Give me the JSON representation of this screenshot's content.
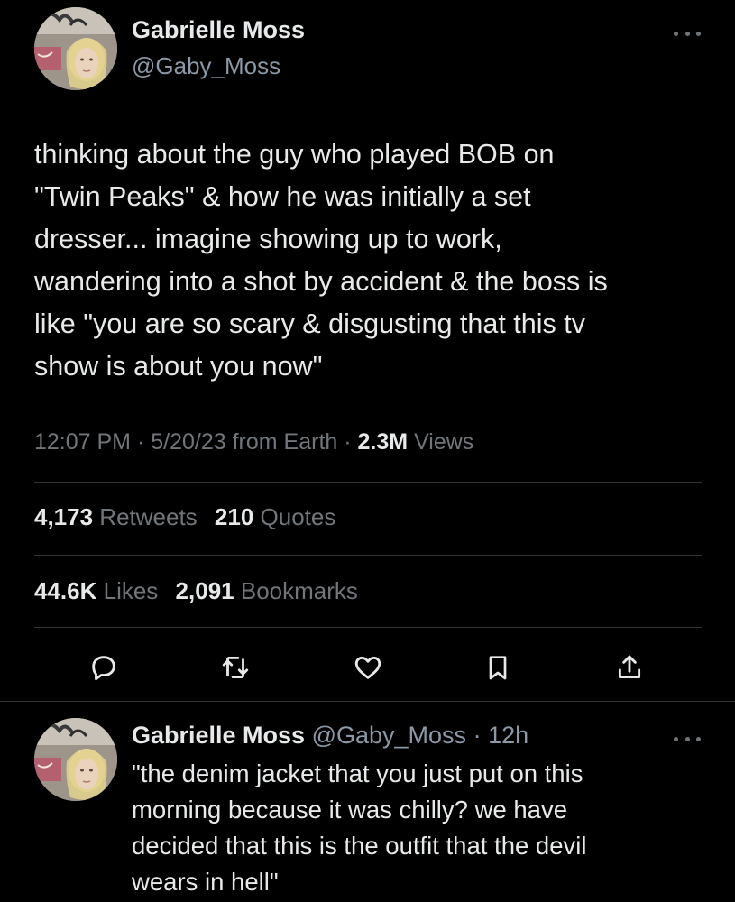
{
  "tweet": {
    "author_name": "Gabrielle Moss",
    "author_handle": "@Gaby_Moss",
    "text_lines": [
      "thinking about the guy who played BOB on",
      "\"Twin Peaks\" & how he was initially a set",
      "dresser... imagine showing up to work,",
      "wandering into a shot by accident & the boss is",
      "like \"you are so scary & disgusting that this tv",
      "show is about you now\""
    ],
    "meta": {
      "time": "12:07 PM",
      "sep1": " · ",
      "date": "5/20/23",
      "source": " from Earth",
      "sep2": " · ",
      "views_count": "2.3M",
      "views_label": " Views"
    },
    "stats_row1": {
      "retweets_count": "4,173",
      "retweets_label": " Retweets",
      "quotes_count": "210",
      "quotes_label": " Quotes"
    },
    "stats_row2": {
      "likes_count": "44.6K",
      "likes_label": " Likes",
      "bookmarks_count": "2,091",
      "bookmarks_label": " Bookmarks"
    },
    "actions": [
      "reply-icon",
      "retweet-icon",
      "like-icon",
      "bookmark-icon",
      "share-icon"
    ]
  },
  "reply": {
    "author_name": "Gabrielle Moss",
    "author_handle": "@Gaby_Moss",
    "separator": " · ",
    "time": "12h",
    "text_lines": [
      "\"the denim jacket that you just put on this",
      "morning because it was chilly? we have",
      "decided that this is the outfit that the devil",
      "wears in hell\""
    ]
  },
  "colors": {
    "background": "#000000",
    "primary_text": "#e7e9ea",
    "secondary_text": "#71767b",
    "handle_text": "#8b98a5",
    "divider": "#2f3336"
  }
}
